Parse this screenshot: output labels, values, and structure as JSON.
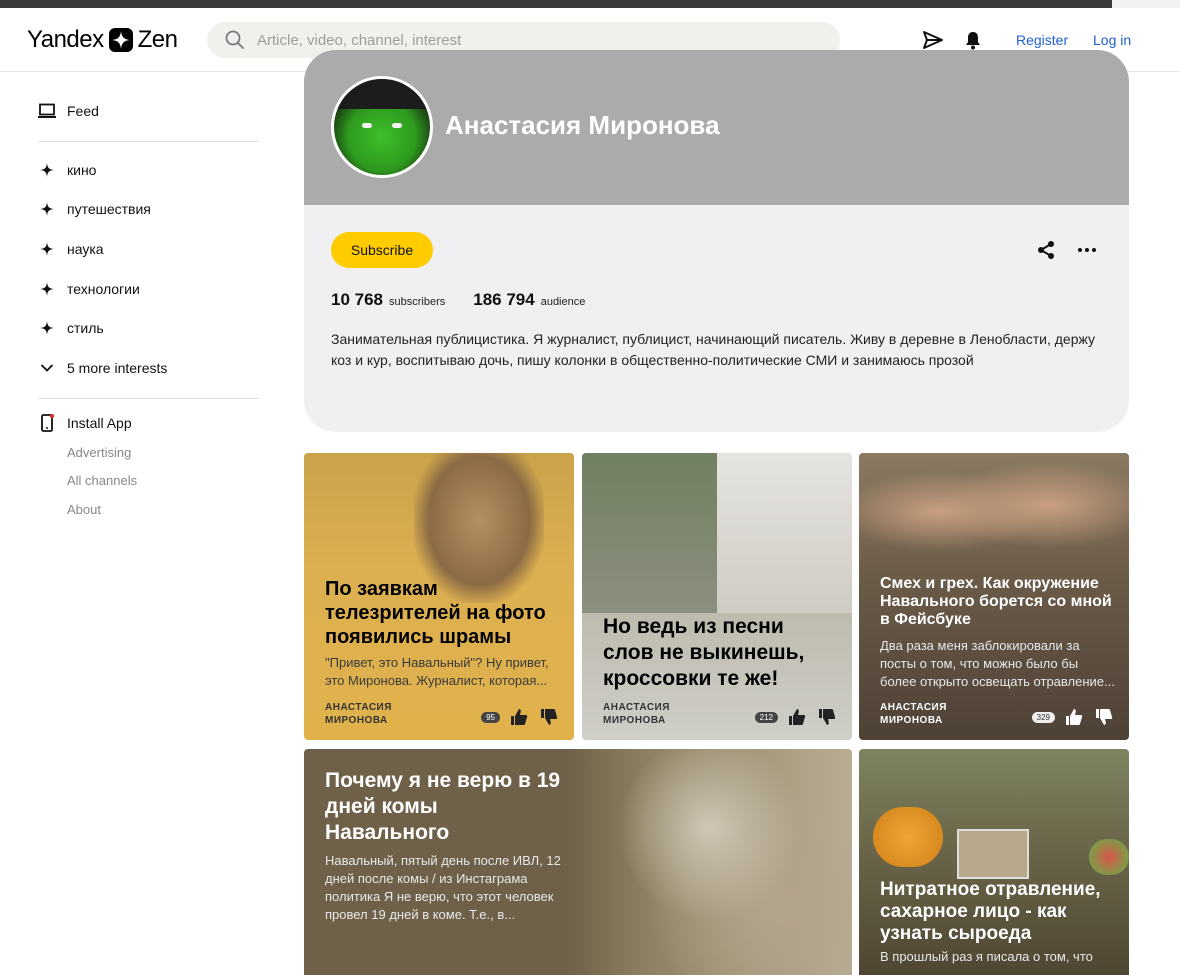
{
  "header": {
    "logo_left": "Yandex",
    "logo_right": "Zen",
    "search_placeholder": "Article, video, channel, interest",
    "register": "Register",
    "login": "Log in"
  },
  "sidebar": {
    "feed": "Feed",
    "interests": [
      "кино",
      "путешествия",
      "наука",
      "технологии",
      "стиль"
    ],
    "more_interests": "5 more interests",
    "install_app": "Install App",
    "links": [
      "Advertising",
      "All channels",
      "About"
    ]
  },
  "channel": {
    "name": "Анастасия Миронова",
    "subscribe": "Subscribe",
    "subscribers_count": "10 768",
    "subscribers_label": "subscribers",
    "audience_count": "186 794",
    "audience_label": "audience",
    "description": "Занимательная публицистика. Я журналист, публицист, начинающий писатель. Живу в деревне в Ленобласти, держу коз и кур, воспитываю дочь, пишу колонки в общественно-политические СМИ и занимаюсь прозой"
  },
  "cards": [
    {
      "title": "По заявкам телезрителей на фото появились шрамы",
      "excerpt": "\"Привет, это Навальный\"? Ну привет, это Миронова. Журналист, которая...",
      "author": "АНАСТАСИЯ МИРОНОВА",
      "count": "95",
      "bg": "#d9ad48"
    },
    {
      "title": "Но ведь из песни слов не выкинешь, кроссовки те же!",
      "excerpt": "",
      "author": "АНАСТАСИЯ МИРОНОВА",
      "count": "212",
      "bg": "#c9c8c0"
    },
    {
      "title": "Смех и грех. Как окружение Навального борется со мной в Фейсбуке",
      "excerpt": "Два раза меня заблокировали за посты о том, что можно было бы более открыто освещать отравление...",
      "author": "АНАСТАСИЯ МИРОНОВА",
      "count": "329",
      "bg": "#5a4a3e"
    },
    {
      "title": "Почему я не верю в 19 дней комы Навального",
      "excerpt": "Навальный, пятый день после ИВЛ, 12 дней после комы / из Инстаграма политика Я не верю, что этот человек провел 19 дней в коме. Т.е., в...",
      "bg": "#6f6149"
    },
    {
      "title": "Нитратное отравление, сахарное лицо - как узнать сыроеда",
      "excerpt": "В прошлый раз я писала о том, что",
      "bg": "#4f4633"
    }
  ]
}
